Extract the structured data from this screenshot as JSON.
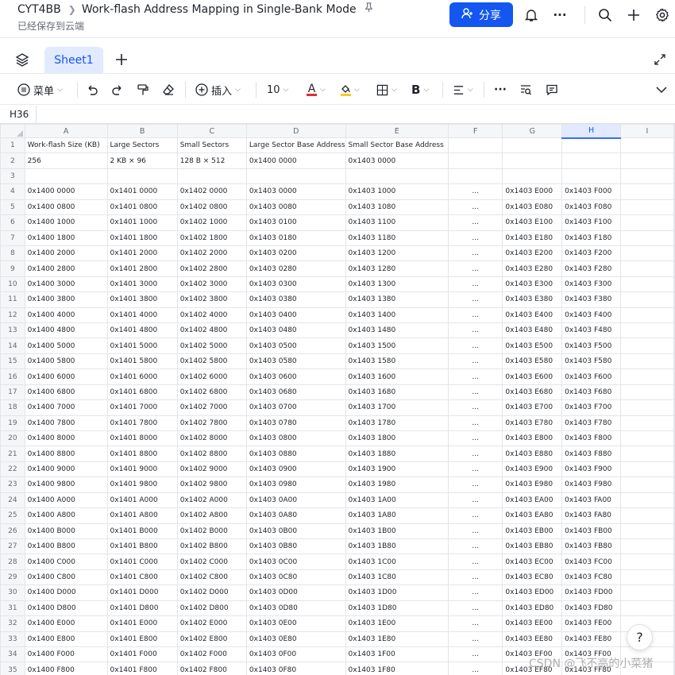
{
  "header": {
    "breadcrumb_root": "CYT4BB",
    "title": "Work-flash Address Mapping in Single-Bank Mode",
    "saved_status": "已经保存到云端",
    "share_label": "分享"
  },
  "tabs": {
    "sheet_name": "Sheet1"
  },
  "toolbar": {
    "menu_label": "菜单",
    "insert_label": "插入",
    "font_size": "10",
    "font_color_glyph": "A",
    "bold_glyph": "B",
    "more_glyph": "···"
  },
  "colors": {
    "accent": "#1456f0",
    "font_color_bar": "#e02e2e",
    "fill_color_bar": "#f8cc1f"
  },
  "formula_bar": {
    "cell_ref": "H36"
  },
  "grid": {
    "columns": [
      "A",
      "B",
      "C",
      "D",
      "E",
      "F",
      "G",
      "H",
      "I"
    ],
    "selected_column": "H",
    "rows": [
      {
        "n": "1",
        "cells": [
          "Work-flash Size (KB)",
          "Large Sectors",
          "Small Sectors",
          "Large Sector Base Address",
          "Small Sector Base Address",
          "",
          "",
          "",
          ""
        ]
      },
      {
        "n": "2",
        "cells": [
          "256",
          "2 KB × 96",
          "128 B × 512",
          "0x1400 0000",
          "0x1403 0000",
          "",
          "",
          "",
          ""
        ]
      },
      {
        "n": "3",
        "cells": [
          "",
          "",
          "",
          "",
          "",
          "",
          "",
          "",
          ""
        ]
      },
      {
        "n": "4",
        "cells": [
          "0x1400 0000",
          "0x1401 0000",
          "0x1402 0000",
          "0x1403 0000",
          "0x1403 1000",
          "...",
          "0x1403 E000",
          "0x1403 F000",
          ""
        ]
      },
      {
        "n": "5",
        "cells": [
          "0x1400 0800",
          "0x1401 0800",
          "0x1402 0800",
          "0x1403 0080",
          "0x1403 1080",
          "...",
          "0x1403 E080",
          "0x1403 F080",
          ""
        ]
      },
      {
        "n": "6",
        "cells": [
          "0x1400 1000",
          "0x1401 1000",
          "0x1402 1000",
          "0x1403 0100",
          "0x1403 1100",
          "...",
          "0x1403 E100",
          "0x1403 F100",
          ""
        ]
      },
      {
        "n": "7",
        "cells": [
          "0x1400 1800",
          "0x1401 1800",
          "0x1402 1800",
          "0x1403 0180",
          "0x1403 1180",
          "...",
          "0x1403 E180",
          "0x1403 F180",
          ""
        ]
      },
      {
        "n": "8",
        "cells": [
          "0x1400 2000",
          "0x1401 2000",
          "0x1402 2000",
          "0x1403 0200",
          "0x1403 1200",
          "...",
          "0x1403 E200",
          "0x1403 F200",
          ""
        ]
      },
      {
        "n": "9",
        "cells": [
          "0x1400 2800",
          "0x1401 2800",
          "0x1402 2800",
          "0x1403 0280",
          "0x1403 1280",
          "...",
          "0x1403 E280",
          "0x1403 F280",
          ""
        ]
      },
      {
        "n": "10",
        "cells": [
          "0x1400 3000",
          "0x1401 3000",
          "0x1402 3000",
          "0x1403 0300",
          "0x1403 1300",
          "...",
          "0x1403 E300",
          "0x1403 F300",
          ""
        ]
      },
      {
        "n": "11",
        "cells": [
          "0x1400 3800",
          "0x1401 3800",
          "0x1402 3800",
          "0x1403 0380",
          "0x1403 1380",
          "...",
          "0x1403 E380",
          "0x1403 F380",
          ""
        ]
      },
      {
        "n": "12",
        "cells": [
          "0x1400 4000",
          "0x1401 4000",
          "0x1402 4000",
          "0x1403 0400",
          "0x1403 1400",
          "...",
          "0x1403 E400",
          "0x1403 F400",
          ""
        ]
      },
      {
        "n": "13",
        "cells": [
          "0x1400 4800",
          "0x1401 4800",
          "0x1402 4800",
          "0x1403 0480",
          "0x1403 1480",
          "...",
          "0x1403 E480",
          "0x1403 F480",
          ""
        ]
      },
      {
        "n": "14",
        "cells": [
          "0x1400 5000",
          "0x1401 5000",
          "0x1402 5000",
          "0x1403 0500",
          "0x1403 1500",
          "...",
          "0x1403 E500",
          "0x1403 F500",
          ""
        ]
      },
      {
        "n": "15",
        "cells": [
          "0x1400 5800",
          "0x1401 5800",
          "0x1402 5800",
          "0x1403 0580",
          "0x1403 1580",
          "...",
          "0x1403 E580",
          "0x1403 F580",
          ""
        ]
      },
      {
        "n": "16",
        "cells": [
          "0x1400 6000",
          "0x1401 6000",
          "0x1402 6000",
          "0x1403 0600",
          "0x1403 1600",
          "...",
          "0x1403 E600",
          "0x1403 F600",
          ""
        ]
      },
      {
        "n": "17",
        "cells": [
          "0x1400 6800",
          "0x1401 6800",
          "0x1402 6800",
          "0x1403 0680",
          "0x1403 1680",
          "...",
          "0x1403 E680",
          "0x1403 F680",
          ""
        ]
      },
      {
        "n": "18",
        "cells": [
          "0x1400 7000",
          "0x1401 7000",
          "0x1402 7000",
          "0x1403 0700",
          "0x1403 1700",
          "...",
          "0x1403 E700",
          "0x1403 F700",
          ""
        ]
      },
      {
        "n": "19",
        "cells": [
          "0x1400 7800",
          "0x1401 7800",
          "0x1402 7800",
          "0x1403 0780",
          "0x1403 1780",
          "...",
          "0x1403 E780",
          "0x1403 F780",
          ""
        ]
      },
      {
        "n": "20",
        "cells": [
          "0x1400 8000",
          "0x1401 8000",
          "0x1402 8000",
          "0x1403 0800",
          "0x1403 1800",
          "...",
          "0x1403 E800",
          "0x1403 F800",
          ""
        ]
      },
      {
        "n": "21",
        "cells": [
          "0x1400 8800",
          "0x1401 8800",
          "0x1402 8800",
          "0x1403 0880",
          "0x1403 1880",
          "...",
          "0x1403 E880",
          "0x1403 F880",
          ""
        ]
      },
      {
        "n": "22",
        "cells": [
          "0x1400 9000",
          "0x1401 9000",
          "0x1402 9000",
          "0x1403 0900",
          "0x1403 1900",
          "...",
          "0x1403 E900",
          "0x1403 F900",
          ""
        ]
      },
      {
        "n": "23",
        "cells": [
          "0x1400 9800",
          "0x1401 9800",
          "0x1402 9800",
          "0x1403 0980",
          "0x1403 1980",
          "...",
          "0x1403 E980",
          "0x1403 F980",
          ""
        ]
      },
      {
        "n": "24",
        "cells": [
          "0x1400 A000",
          "0x1401 A000",
          "0x1402 A000",
          "0x1403 0A00",
          "0x1403 1A00",
          "...",
          "0x1403 EA00",
          "0x1403 FA00",
          ""
        ]
      },
      {
        "n": "25",
        "cells": [
          "0x1400 A800",
          "0x1401 A800",
          "0x1402 A800",
          "0x1403 0A80",
          "0x1403 1A80",
          "...",
          "0x1403 EA80",
          "0x1403 FA80",
          ""
        ]
      },
      {
        "n": "26",
        "cells": [
          "0x1400 B000",
          "0x1401 B000",
          "0x1402 B000",
          "0x1403 0B00",
          "0x1403 1B00",
          "...",
          "0x1403 EB00",
          "0x1403 FB00",
          ""
        ]
      },
      {
        "n": "27",
        "cells": [
          "0x1400 B800",
          "0x1401 B800",
          "0x1402 B800",
          "0x1403 0B80",
          "0x1403 1B80",
          "...",
          "0x1403 EB80",
          "0x1403 FB80",
          ""
        ]
      },
      {
        "n": "28",
        "cells": [
          "0x1400 C000",
          "0x1401 C000",
          "0x1402 C000",
          "0x1403 0C00",
          "0x1403 1C00",
          "...",
          "0x1403 EC00",
          "0x1403 FC00",
          ""
        ]
      },
      {
        "n": "29",
        "cells": [
          "0x1400 C800",
          "0x1401 C800",
          "0x1402 C800",
          "0x1403 0C80",
          "0x1403 1C80",
          "...",
          "0x1403 EC80",
          "0x1403 FC80",
          ""
        ]
      },
      {
        "n": "30",
        "cells": [
          "0x1400 D000",
          "0x1401 D000",
          "0x1402 D000",
          "0x1403 0D00",
          "0x1403 1D00",
          "...",
          "0x1403 ED00",
          "0x1403 FD00",
          ""
        ]
      },
      {
        "n": "31",
        "cells": [
          "0x1400 D800",
          "0x1401 D800",
          "0x1402 D800",
          "0x1403 0D80",
          "0x1403 1D80",
          "...",
          "0x1403 ED80",
          "0x1403 FD80",
          ""
        ]
      },
      {
        "n": "32",
        "cells": [
          "0x1400 E000",
          "0x1401 E000",
          "0x1402 E000",
          "0x1403 0E00",
          "0x1403 1E00",
          "...",
          "0x1403 EE00",
          "0x1403 FE00",
          ""
        ]
      },
      {
        "n": "33",
        "cells": [
          "0x1400 E800",
          "0x1401 E800",
          "0x1402 E800",
          "0x1403 0E80",
          "0x1403 1E80",
          "...",
          "0x1403 EE80",
          "0x1403 FE80",
          ""
        ]
      },
      {
        "n": "34",
        "cells": [
          "0x1400 F000",
          "0x1401 F000",
          "0x1402 F000",
          "0x1403 0F00",
          "0x1403 1F00",
          "...",
          "0x1403 EF00",
          "0x1403 FF00",
          ""
        ]
      },
      {
        "n": "35",
        "cells": [
          "0x1400 F800",
          "0x1401 F800",
          "0x1402 F800",
          "0x1403 0F80",
          "0x1403 1F80",
          "...",
          "0x1403 EF80",
          "0x1403 FF80",
          ""
        ]
      }
    ]
  },
  "help_glyph": "?",
  "watermark": "CSDN @飞不高的小菜猪"
}
